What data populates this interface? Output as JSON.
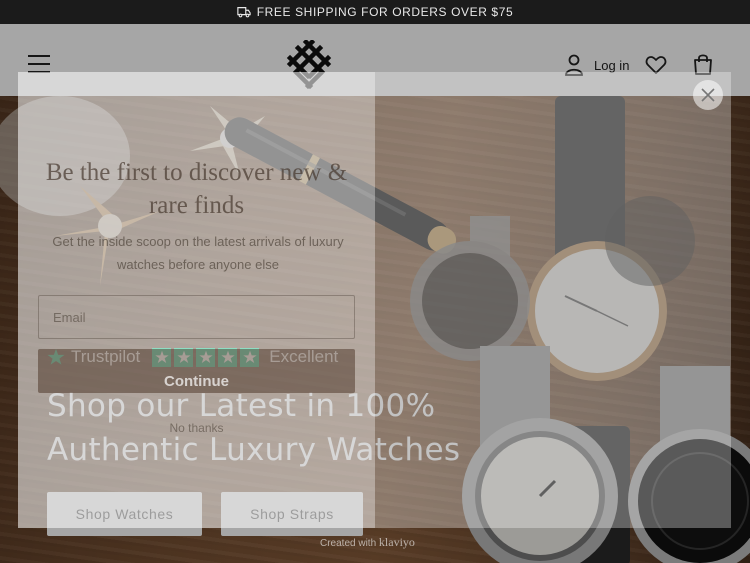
{
  "announcement": {
    "text": "FREE SHIPPING FOR ORDERS OVER $75",
    "icon": "truck-icon"
  },
  "header": {
    "login_label": "Log in",
    "icons": [
      "menu-icon",
      "user-icon",
      "heart-icon",
      "bag-icon"
    ]
  },
  "hero": {
    "headline": "Shop our Latest in 100% Authentic Luxury Watches",
    "buttons": [
      "Shop Watches",
      "Shop Straps"
    ],
    "rating": {
      "brand": "Trustpilot",
      "label": "Excellent",
      "stars": 5
    }
  },
  "popup": {
    "title": "Be the first to discover new & rare finds",
    "subtitle": "Get the inside scoop on the latest arrivals of luxury watches before anyone else",
    "email_placeholder": "Email",
    "continue_label": "Continue",
    "dismiss_label": "No thanks",
    "footer_prefix": "Created with",
    "footer_brand": "klaviyo"
  },
  "colors": {
    "trustpilot_green": "#00b67a",
    "announcement_bg": "#1b1b1b"
  }
}
